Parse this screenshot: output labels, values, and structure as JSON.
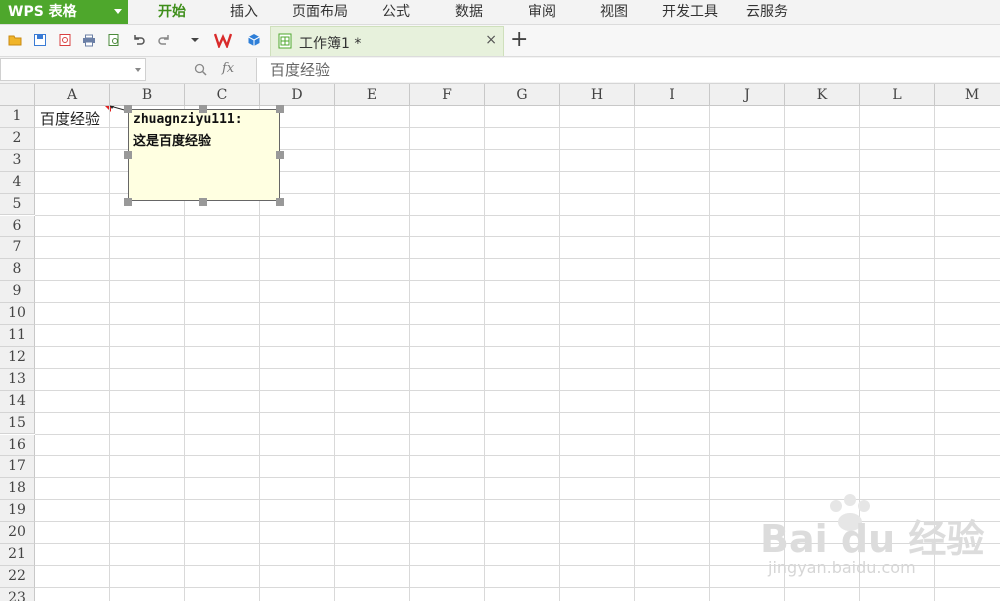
{
  "app": {
    "name": "WPS 表格"
  },
  "menu": [
    "开始",
    "插入",
    "页面布局",
    "公式",
    "数据",
    "审阅",
    "视图",
    "开发工具",
    "云服务"
  ],
  "document_tab": {
    "label": "工作簿1 *",
    "close": "×",
    "add": "+"
  },
  "formula_bar": {
    "name_box_value": "",
    "fx_label": "fx",
    "content": "百度经验"
  },
  "sheet": {
    "columns": [
      "A",
      "B",
      "C",
      "D",
      "E",
      "F",
      "G",
      "H",
      "I",
      "J",
      "K",
      "L",
      "M"
    ],
    "rows": [
      "1",
      "2",
      "3",
      "4",
      "5",
      "6",
      "7",
      "8",
      "9",
      "10",
      "11",
      "12",
      "13",
      "14",
      "15",
      "16",
      "17",
      "18",
      "19",
      "20",
      "21",
      "22",
      "23"
    ],
    "cell_a1": "百度经验"
  },
  "comment": {
    "author": "zhuagnziyu111:",
    "text": "这是百度经验"
  },
  "watermark": {
    "brand": "Bai du 经验",
    "url": "jingyan.baidu.com"
  },
  "colors": {
    "app_green": "#4ea72c",
    "active_menu": "#3e8e1a",
    "comment_bg": "#ffffe1",
    "tab_bg": "#e7f1dc"
  }
}
